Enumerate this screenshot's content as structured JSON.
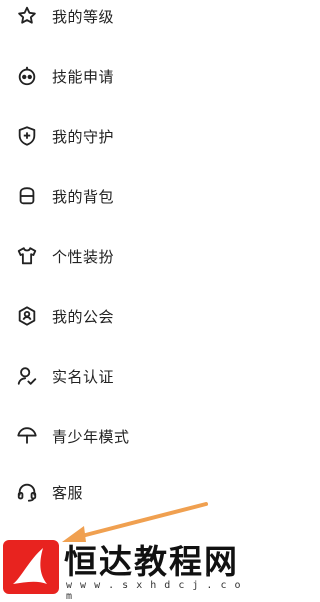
{
  "menu": {
    "items": [
      {
        "label": "我的等级",
        "icon": "star-icon"
      },
      {
        "label": "技能申请",
        "icon": "robot-face-icon"
      },
      {
        "label": "我的守护",
        "icon": "shield-plus-icon"
      },
      {
        "label": "我的背包",
        "icon": "backpack-icon"
      },
      {
        "label": "个性装扮",
        "icon": "tshirt-icon"
      },
      {
        "label": "我的公会",
        "icon": "guild-badge-icon"
      },
      {
        "label": "实名认证",
        "icon": "user-check-icon"
      },
      {
        "label": "青少年模式",
        "icon": "umbrella-icon"
      },
      {
        "label": "客服",
        "icon": "headset-icon"
      }
    ]
  },
  "watermark": {
    "title": "恒达教程网",
    "url": "w w w . s x h d c j . c o m"
  },
  "colors": {
    "text": "#222222",
    "icon": "#222222",
    "arrow": "#f0a050",
    "logo_red": "#e8231f"
  }
}
